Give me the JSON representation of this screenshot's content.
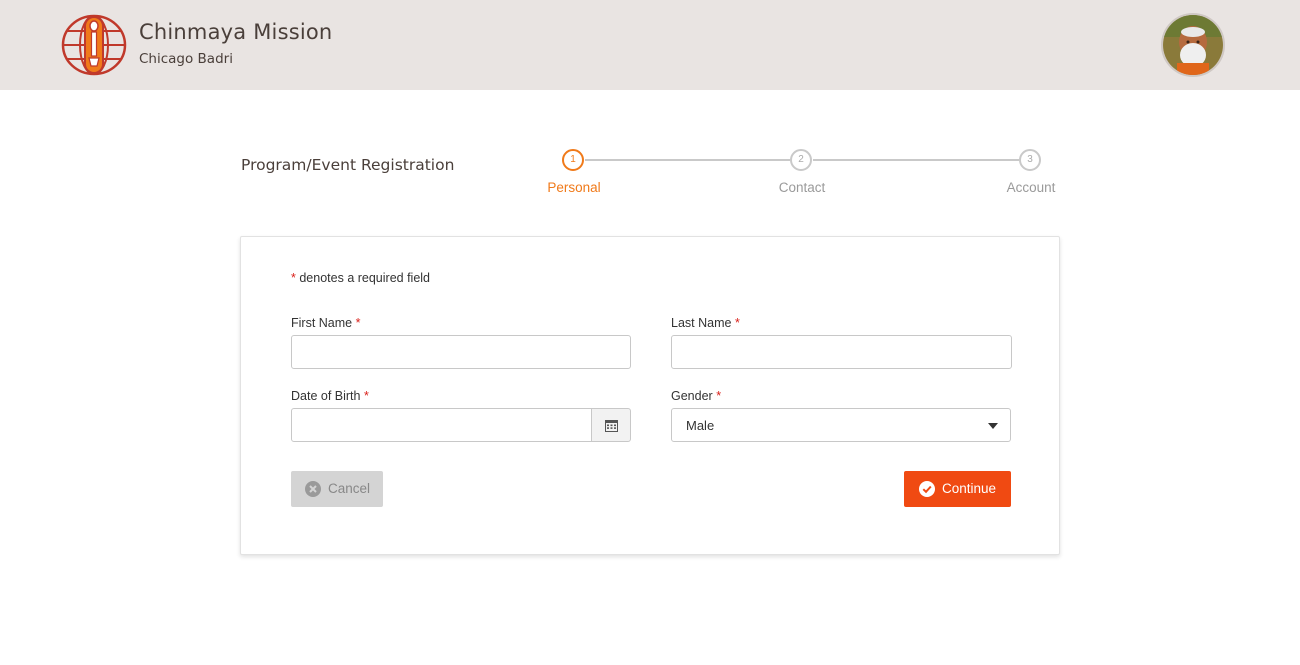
{
  "header": {
    "org_name": "Chinmaya Mission",
    "chapter": "Chicago Badri",
    "logo_icon": "chinmaya-mission-globe-logo",
    "avatar_icon": "profile-avatar"
  },
  "page": {
    "title": "Program/Event Registration"
  },
  "stepper": {
    "steps": [
      {
        "number": "1",
        "label": "Personal",
        "active": true
      },
      {
        "number": "2",
        "label": "Contact",
        "active": false
      },
      {
        "number": "3",
        "label": "Account",
        "active": false
      }
    ],
    "active_color": "#f07a1a",
    "inactive_color": "#c9c9c9"
  },
  "form": {
    "required_marker": "*",
    "required_note": "denotes a required field",
    "fields": {
      "first_name": {
        "label": "First Name",
        "value": ""
      },
      "last_name": {
        "label": "Last Name",
        "value": ""
      },
      "dob": {
        "label": "Date of Birth",
        "value": ""
      },
      "gender": {
        "label": "Gender",
        "value": "Male"
      }
    },
    "buttons": {
      "cancel": "Cancel",
      "continue": "Continue"
    }
  },
  "colors": {
    "header_bg": "#e9e4e2",
    "accent": "#f04a12",
    "required": "#d91e18"
  }
}
